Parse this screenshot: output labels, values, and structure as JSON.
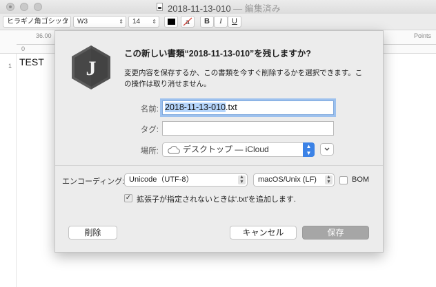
{
  "window": {
    "title": "2018-11-13-010",
    "status": " — 編集済み"
  },
  "toolbar": {
    "font_family": "ヒラギノ角ゴシック",
    "font_weight": "W3",
    "font_size": "14",
    "text_color": "#000000",
    "bold": "B",
    "italic": "I",
    "underline": "U"
  },
  "ruler": {
    "position": "36.00",
    "zero": "0",
    "units": "Points"
  },
  "editor": {
    "line_number": "1",
    "text": "TEST"
  },
  "sheet": {
    "title": "この新しい書類“2018-11-13-010”を残しますか?",
    "message": "変更内容を保存するか、この書類を今すぐ削除するかを選択できます。この操作は取り消せません。",
    "name_label": "名前:",
    "name_selected": "2018-11-13-010",
    "name_extension": ".txt",
    "tags_label": "タグ:",
    "tags_value": "",
    "location_label": "場所:",
    "location_value": "デスクトップ — iCloud",
    "encoding_label": "エンコーディング:",
    "encoding_value": "Unicode（UTF-8）",
    "line_ending_value": "macOS/Unix (LF)",
    "bom_label": "BOM",
    "bom_checked": false,
    "extension_label": "拡張子が指定されないときは'.txt'を追加します.",
    "extension_checked": true,
    "delete_button": "削除",
    "cancel_button": "キャンセル",
    "save_button": "保存"
  },
  "colors": {
    "accent": "#3b82e6",
    "selection": "#b4d4fa",
    "save_button_disabled": "#a6a6a6",
    "sheet_background": "#ececec"
  }
}
